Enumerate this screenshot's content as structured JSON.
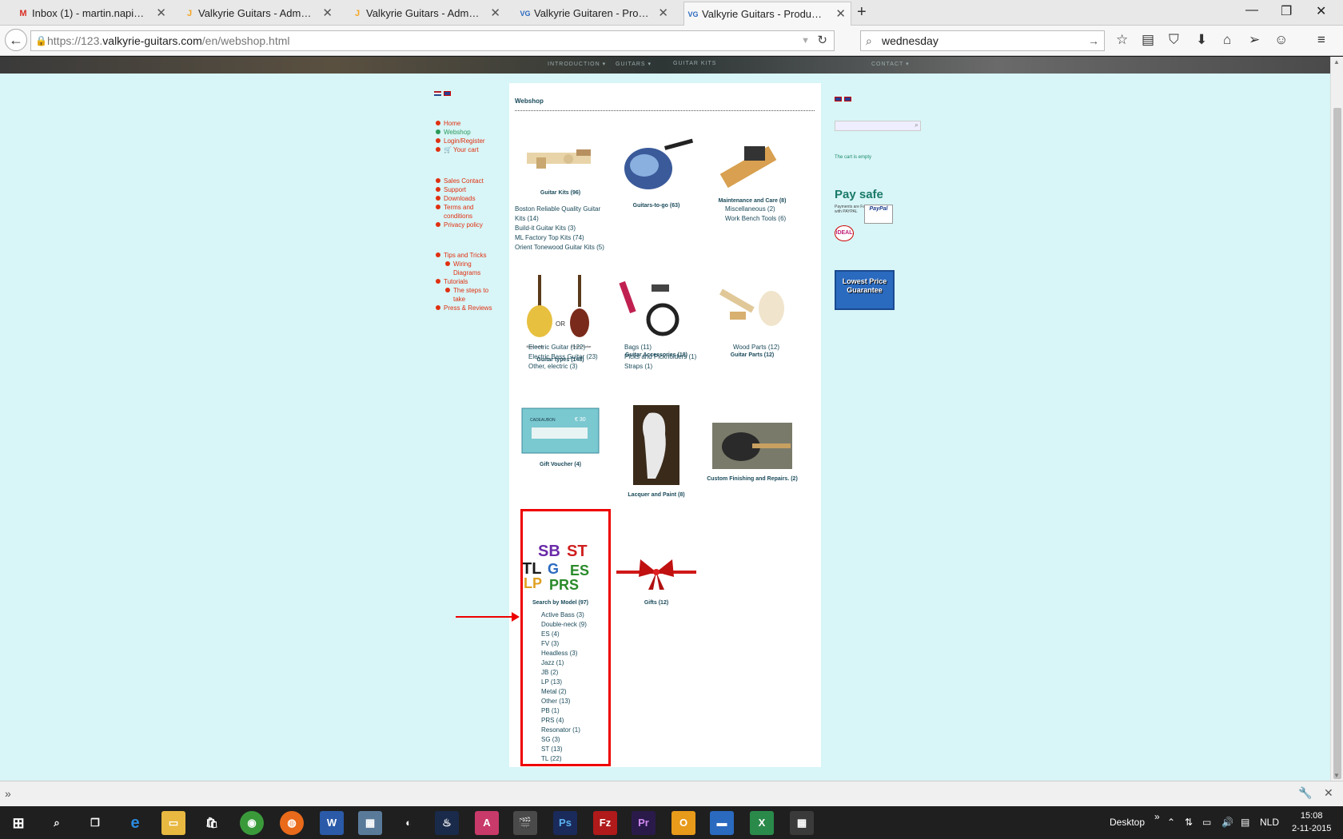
{
  "browser": {
    "tabs": [
      {
        "label": "Inbox (1) - martin.napier@...",
        "icon": "M",
        "icon_color": "#d93025"
      },
      {
        "label": "Valkyrie Guitars - Adminis...",
        "icon": "J",
        "icon_color": "#f5a623"
      },
      {
        "label": "Valkyrie Guitars - Adminis...",
        "icon": "J",
        "icon_color": "#f5a623"
      },
      {
        "label": "Valkyrie Guitaren - Produc...",
        "icon": "VG",
        "icon_color": "#2a6abf"
      },
      {
        "label": "Valkyrie Guitars - Product ...",
        "icon": "VG",
        "icon_color": "#2a6abf"
      }
    ],
    "url_prefix": "https://123.",
    "url_domain": "valkyrie-guitars.com",
    "url_path": "/en/webshop.html",
    "search_value": "wednesday"
  },
  "page": {
    "banner_menu": [
      "INTRODUCTION ▾",
      "GUITARS ▾",
      "GUITAR KITS",
      "CONTACT ▾"
    ],
    "sidebar": {
      "group1": [
        {
          "label": "Home",
          "cls": ""
        },
        {
          "label": "Webshop",
          "cls": "green"
        },
        {
          "label": "Login/Register",
          "cls": ""
        },
        {
          "label": "🛒 Your cart",
          "cls": ""
        }
      ],
      "group2": [
        {
          "label": "Sales Contact",
          "cls": ""
        },
        {
          "label": "Support",
          "cls": ""
        },
        {
          "label": "Downloads",
          "cls": ""
        },
        {
          "label": "Terms and conditions",
          "cls": ""
        },
        {
          "label": "Privacy policy",
          "cls": ""
        }
      ],
      "group3": [
        {
          "label": "Tips and Tricks",
          "cls": ""
        },
        {
          "label": "Wiring Diagrams",
          "cls": "sub"
        },
        {
          "label": "Tutorials",
          "cls": ""
        },
        {
          "label": "The steps to take",
          "cls": "sub"
        },
        {
          "label": "Press & Reviews",
          "cls": ""
        }
      ]
    },
    "webshop_title": "Webshop",
    "categories": [
      {
        "name": "Guitar Kits (96)",
        "sub": [
          "Boston Reliable Quality Guitar Kits (14)",
          "Build-it Guitar Kits (3)",
          "ML Factory Top Kits (74)",
          "Orient Tonewood Guitar Kits (5)"
        ]
      },
      {
        "name": "Guitars-to-go (63)",
        "sub": []
      },
      {
        "name": "Maintenance and Care (8)",
        "sub": [
          "Miscellaneous (2)",
          "Work Bench Tools (6)"
        ]
      },
      {
        "name": "Guitar types (148)",
        "sub": [
          "Electric Guitar (122)",
          "Electric Bass Guitar (23)",
          "Other, electric (3)"
        ]
      },
      {
        "name": "Guitar Accessories (18)",
        "sub": [
          "Bags (11)",
          "Picks and Pickholders (1)",
          "Straps (1)"
        ]
      },
      {
        "name": "Guitar Parts (12)",
        "sub": [
          "Wood Parts (12)"
        ]
      },
      {
        "name": "Gift Voucher (4)",
        "sub": []
      },
      {
        "name": "Lacquer and Paint (8)",
        "sub": []
      },
      {
        "name": "Custom Finishing and Repairs. (2)",
        "sub": []
      },
      {
        "name": "Search by Model (97)",
        "sub": [
          "Active Bass (3)",
          "Double-neck (9)",
          "ES (4)",
          "FV (3)",
          "Headless (3)",
          "Jazz (1)",
          "JB (2)",
          "LP (13)",
          "Metal (2)",
          "Other (13)",
          "PB (1)",
          "PRS (4)",
          "Resonator (1)",
          "SG (3)",
          "ST (13)",
          "TL (22)"
        ]
      },
      {
        "name": "Gifts (12)",
        "sub": []
      }
    ],
    "image_text": {
      "guitar_types_left": "Bass Guitar",
      "guitar_types_mid": "OR",
      "guitar_types_right": "Electric Guitar",
      "voucher_title": "CADEAUBON",
      "voucher_amount": "€ 30",
      "model_logo": [
        "SB",
        "ST",
        "TL",
        "ES",
        "LP",
        "PRS",
        "G"
      ]
    },
    "right": {
      "cart_text": "The cart is empty",
      "pay_title": "Pay safe",
      "pay_small": "Payments are Fast and Secure with PAYPAL",
      "paypal": "PayPal",
      "ideal": "iDEAL",
      "lowest": "Lowest Price Guarantee"
    }
  },
  "taskbar": {
    "desktop_label": "Desktop",
    "lang": "NLD",
    "time": "15:08",
    "date": "2-11-2015"
  },
  "colors": {
    "page_bg": "#d8f5f7",
    "link_red": "#e03010",
    "highlight": "#e00000"
  }
}
